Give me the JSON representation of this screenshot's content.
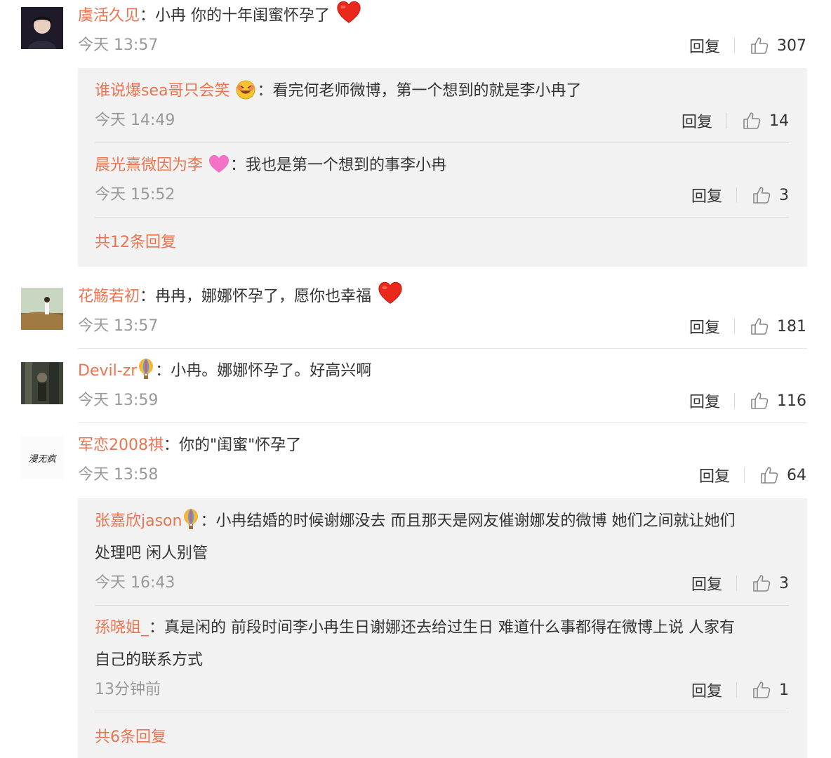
{
  "reply_label": "回复",
  "comments": [
    {
      "user": "虞活久见",
      "text": "小冉 你的十年闺蜜怀孕了",
      "time": "今天 13:57",
      "likes": "307"
    },
    {
      "user": "花觞若初",
      "text": "冉冉，娜娜怀孕了，愿你也幸福",
      "time": "今天 13:57",
      "likes": "181"
    },
    {
      "user": "Devil-zr",
      "text": "小冉。娜娜怀孕了。好高兴啊",
      "time": "今天 13:59",
      "likes": "116"
    },
    {
      "user": "军恋2008祺",
      "text": "你的\"闺蜜\"怀孕了",
      "time": "今天 13:58",
      "likes": "64"
    }
  ],
  "replies1": [
    {
      "user": "谁说爆sea哥只会笑",
      "text": "看完何老师微博，第一个想到的就是李小冉了",
      "time": "今天 14:49",
      "likes": "14"
    },
    {
      "user": "晨光熹微因为李",
      "text": "我也是第一个想到的事李小冉",
      "time": "今天 15:52",
      "likes": "3"
    }
  ],
  "replies1_more": "共12条回复",
  "replies4": [
    {
      "user": "张嘉欣jason",
      "text1": "小冉结婚的时候谢娜没去 而且那天是网友催谢娜发的微博 她们之间就让她们",
      "text2": "处理吧 闲人别管",
      "time": "今天 16:43",
      "likes": "3"
    },
    {
      "user": "孫晓姐_",
      "text1": "真是闲的 前段时间李小冉生日谢娜还去给过生日 难道什么事都得在微博上说 人家有",
      "text2": "自己的联系方式",
      "time": "13分钟前",
      "likes": "1"
    }
  ],
  "replies4_more": "共6条回复",
  "avatar4_text": "漫无疯",
  "colors": {
    "name": "#eb7350",
    "time": "#999999",
    "box": "#f2f2f2",
    "heart": "#e8291c"
  }
}
